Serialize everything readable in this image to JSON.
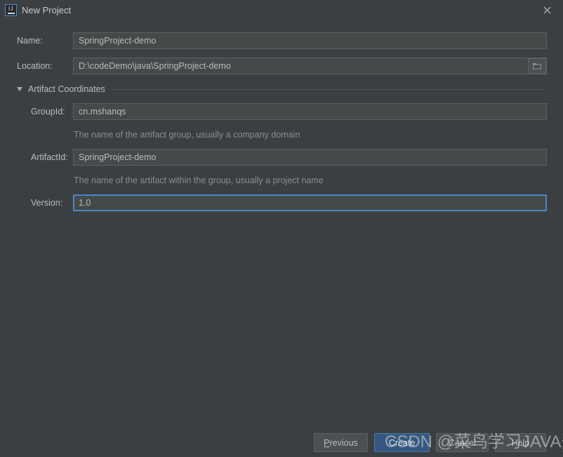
{
  "window": {
    "title": "New Project",
    "app_icon": "intellij-idea-icon",
    "close_icon": "close-icon"
  },
  "form": {
    "name": {
      "label": "Name:",
      "value": "SpringProject-demo",
      "placeholder": ""
    },
    "location": {
      "label": "Location:",
      "value": "D:\\codeDemo\\java\\SpringProject-demo",
      "placeholder": "",
      "browse_icon": "folder-icon"
    },
    "section": {
      "label": "Artifact Coordinates",
      "expanded": true,
      "toggle_icon": "chevron-down-icon"
    },
    "group_id": {
      "label": "GroupId:",
      "value": "cn.mshanqs",
      "placeholder": "",
      "helper": "The name of the artifact group, usually a company domain"
    },
    "artifact_id": {
      "label": "ArtifactId:",
      "value": "SpringProject-demo",
      "placeholder": "",
      "helper": "The name of the artifact within the group, usually a project name"
    },
    "version": {
      "label": "Version:",
      "value": "1.0",
      "placeholder": "",
      "focused": true
    }
  },
  "buttons": {
    "previous": {
      "label": "Previous",
      "mnemonic": "P",
      "rest": "revious"
    },
    "create": {
      "label": "Create"
    },
    "cancel": {
      "label": "Cancel"
    },
    "help": {
      "label": "Help"
    }
  },
  "watermark": {
    "text": "CSDN @菜鸟学习JAVA开发"
  },
  "colors": {
    "background": "#3c3f41",
    "field_background": "#45494a",
    "field_border": "#5e6060",
    "focus_border": "#4a88c7",
    "primary_button": "#365880",
    "text": "#bbbbbb",
    "helper_text": "#8a8d8f"
  }
}
